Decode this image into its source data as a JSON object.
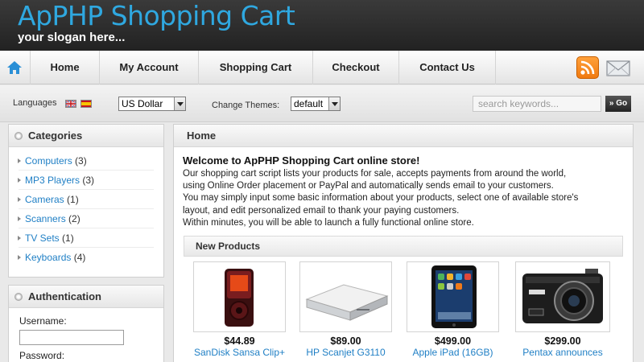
{
  "header": {
    "title": "ApPHP Shopping Cart",
    "slogan": "your slogan here..."
  },
  "nav": {
    "items": [
      {
        "label": "Home"
      },
      {
        "label": "My Account"
      },
      {
        "label": "Shopping Cart"
      },
      {
        "label": "Checkout"
      },
      {
        "label": "Contact Us"
      }
    ],
    "icons": [
      "home-icon",
      "rss-icon",
      "mail-icon"
    ]
  },
  "toolbar": {
    "languages_label": "Languages",
    "currency": "US Dollar",
    "themes_label": "Change Themes:",
    "theme": "default",
    "search_placeholder": "search keywords...",
    "go_label": "Go"
  },
  "categories": {
    "title": "Categories",
    "items": [
      {
        "name": "Computers",
        "count": "(3)"
      },
      {
        "name": "MP3 Players",
        "count": "(3)"
      },
      {
        "name": "Cameras",
        "count": "(1)"
      },
      {
        "name": "Scanners",
        "count": "(2)"
      },
      {
        "name": "TV Sets",
        "count": "(1)"
      },
      {
        "name": "Keyboards",
        "count": "(4)"
      }
    ]
  },
  "auth": {
    "title": "Authentication",
    "username_label": "Username:",
    "password_label": "Password:"
  },
  "main": {
    "title": "Home",
    "welcome_title": "Welcome to ApPHP Shopping Cart online store!",
    "welcome_lines": [
      "Our shopping cart script lists your products for sale, accepts payments from around the world,",
      "using Online Order placement or PayPal and automatically sends email to your customers.",
      "You may simply input some basic information about your products, select one of available store's",
      "layout, and edit  personalized email to thank your paying customers.",
      "Within minutes, you will be able to launch a fully functional online store."
    ],
    "new_products_label": "New Products",
    "products": [
      {
        "price": "$44.89",
        "name": "SanDisk Sansa Clip+"
      },
      {
        "price": "$89.00",
        "name": "HP Scanjet G3110"
      },
      {
        "price": "$499.00",
        "name": "Apple iPad (16GB)"
      },
      {
        "price": "$299.00",
        "name": "Pentax announces"
      }
    ]
  },
  "colors": {
    "header_bg": "#2a2a2a",
    "title_blue": "#2fa8e0",
    "link_blue": "#1f7fc5",
    "rss_orange": "#f58a1f"
  }
}
